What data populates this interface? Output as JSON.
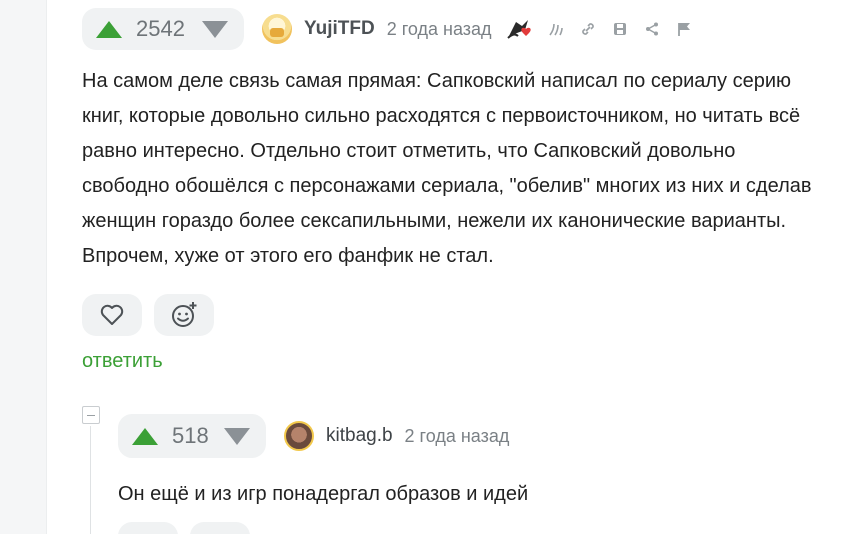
{
  "comment1": {
    "rating": "2542",
    "username": "YujiTFD",
    "timestamp": "2 года назад",
    "text": "На самом деле связь самая прямая: Сапковский написал по сериалу серию книг, которые довольно сильно расходятся с первоисточником, но читать всё равно интересно. Отдельно стоит отметить, что Сапковский довольно свободно обошёлся с персонажами сериала, \"обелив\" многих из них и сделав женщин гораздо более сексапильными, нежели их канонические варианты. Впрочем, хуже от этого его фанфик не стал.",
    "reply_label": "ответить",
    "icons": [
      "badge-icon",
      "hide-branch-icon",
      "link-icon",
      "save-icon",
      "share-icon",
      "flag-icon"
    ]
  },
  "comment2": {
    "rating": "518",
    "username": "kitbag.b",
    "timestamp": "2 года назад",
    "text": "Он ещё и из игр понадергал образов и идей"
  },
  "colors": {
    "accent_green": "#3ba036",
    "vote_bg": "#f0f2f3",
    "downvote_gray": "#8b9196",
    "text": "#222222",
    "muted": "#7a8085"
  }
}
